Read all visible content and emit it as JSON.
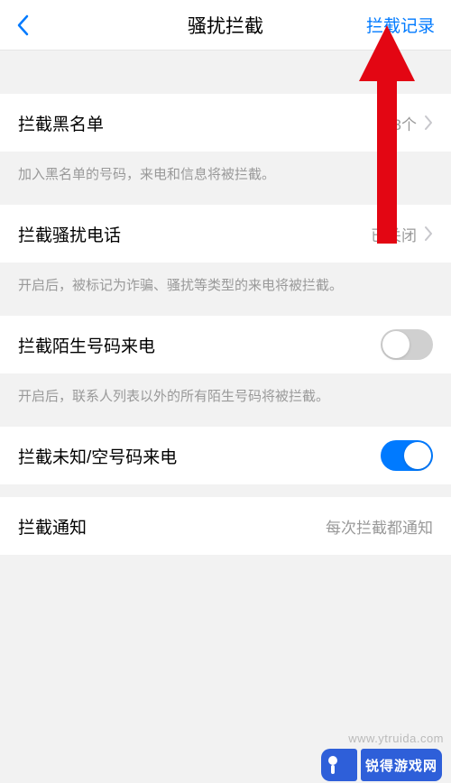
{
  "header": {
    "title": "骚扰拦截",
    "action_label": "拦截记录"
  },
  "sections": {
    "blacklist": {
      "label": "拦截黑名单",
      "value": "3个",
      "desc": "加入黑名单的号码，来电和信息将被拦截。"
    },
    "harass_calls": {
      "label": "拦截骚扰电话",
      "value": "已关闭",
      "desc": "开启后，被标记为诈骗、骚扰等类型的来电将被拦截。"
    },
    "stranger": {
      "label": "拦截陌生号码来电",
      "desc": "开启后，联系人列表以外的所有陌生号码将被拦截。"
    },
    "unknown": {
      "label": "拦截未知/空号码来电"
    },
    "notify": {
      "label": "拦截通知",
      "value": "每次拦截都通知"
    }
  },
  "watermark": {
    "url": "www.ytruida.com",
    "logo_text": "锐得游戏网"
  }
}
